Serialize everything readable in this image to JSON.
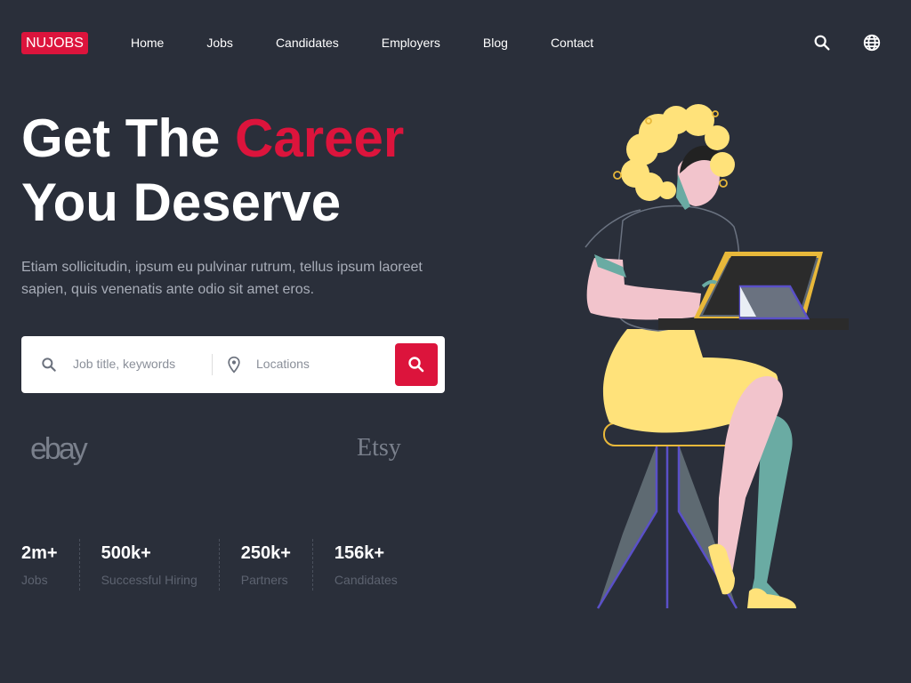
{
  "brand": {
    "logo": "NUJOBS"
  },
  "nav": {
    "links": [
      "Home",
      "Jobs",
      "Candidates",
      "Employers",
      "Blog",
      "Contact"
    ]
  },
  "header_icons": [
    "search-icon",
    "globe-icon"
  ],
  "hero": {
    "title_part1": "Get The ",
    "title_accent": "Career",
    "title_line2": "You Deserve",
    "subtitle": "Etiam sollicitudin, ipsum eu pulvinar rutrum, tellus ipsum laoreet sapien, quis venenatis ante odio sit amet eros."
  },
  "search": {
    "keyword_placeholder": "Job title, keywords",
    "location_placeholder": "Locations"
  },
  "partners": [
    "ebay",
    "Etsy"
  ],
  "stats": [
    {
      "value": "2m+",
      "label": "Jobs"
    },
    {
      "value": "500k+",
      "label": "Successful Hiring"
    },
    {
      "value": "250k+",
      "label": "Partners"
    },
    {
      "value": "156k+",
      "label": "Candidates"
    }
  ],
  "colors": {
    "accent": "#dc143c",
    "background": "#2a2f3a"
  }
}
